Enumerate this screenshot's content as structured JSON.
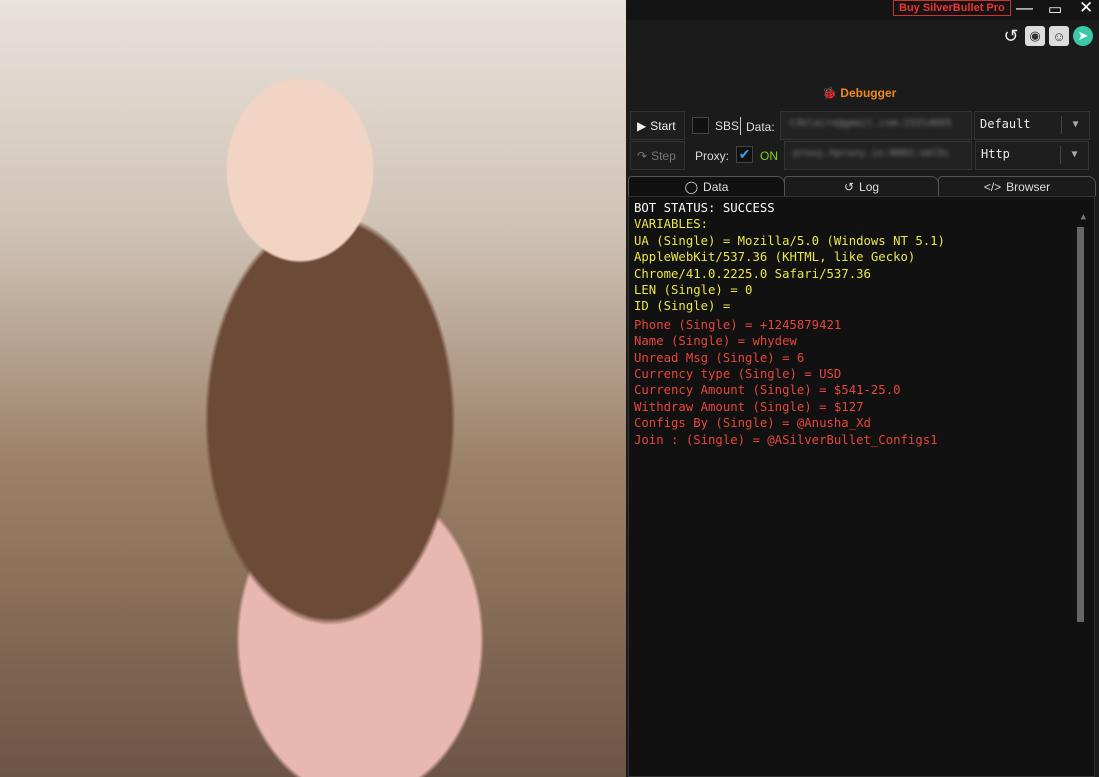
{
  "titlebar": {
    "buy_label": "Buy SilverBullet Pro"
  },
  "header": {
    "title": "Debugger"
  },
  "controls": {
    "start_label": "Start",
    "step_label": "Step",
    "sbs_label": "SBS",
    "data_label": "Data:",
    "data_value": "t3klairo@gmail.com:23314665",
    "proxy_label": "Proxy:",
    "proxy_state": "ON",
    "proxy_value": "proxy.hproxy.io:8002:xml5c",
    "wordlist_type": "Default",
    "proxy_type": "Http"
  },
  "tabs": [
    {
      "label": "Data"
    },
    {
      "label": "Log"
    },
    {
      "label": "Browser"
    }
  ],
  "console": {
    "status": "BOT STATUS: SUCCESS",
    "variables_header": "VARIABLES:",
    "yellow_lines": [
      "UA (Single) = Mozilla/5.0 (Windows NT 5.1)",
      "AppleWebKit/537.36 (KHTML, like Gecko)",
      "Chrome/41.0.2225.0 Safari/537.36",
      "LEN (Single) = 0",
      "ID (Single) ="
    ],
    "red_lines": [
      "Phone (Single) = +1245879421",
      "Name (Single) = whydew",
      "Unread Msg (Single) = 6",
      "Currency type (Single) = USD",
      "Currency Amount (Single) = $541-25.0",
      "Withdraw Amount (Single) = $127",
      "Configs By  (Single) = @Anusha_Xd",
      "Join : (Single) = @ASilverBullet_Configs1"
    ]
  },
  "colors": {
    "accent": "#f08a1c",
    "success": "#e8e84a",
    "captured": "#e8453c",
    "on": "#7ed321"
  }
}
